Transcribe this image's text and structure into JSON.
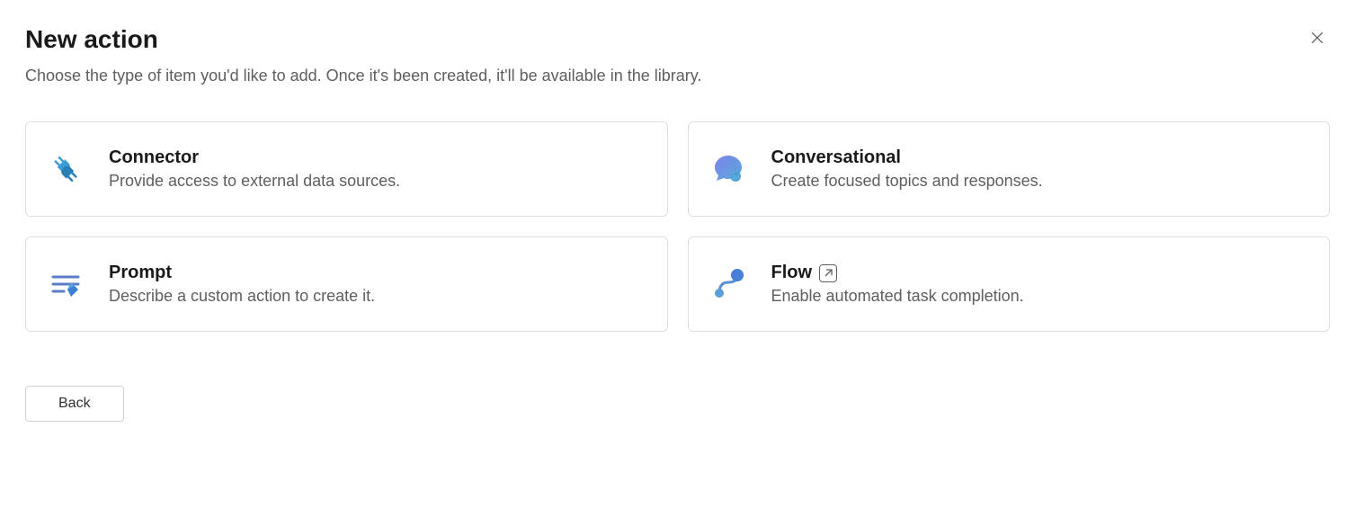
{
  "header": {
    "title": "New action",
    "subtitle": "Choose the type of item you'd like to add. Once it's been created, it'll be available in the library."
  },
  "cards": {
    "connector": {
      "title": "Connector",
      "desc": "Provide access to external data sources."
    },
    "conversational": {
      "title": "Conversational",
      "desc": "Create focused topics and responses."
    },
    "prompt": {
      "title": "Prompt",
      "desc": "Describe a custom action to create it."
    },
    "flow": {
      "title": "Flow",
      "desc": "Enable automated task completion."
    }
  },
  "footer": {
    "back_label": "Back"
  }
}
